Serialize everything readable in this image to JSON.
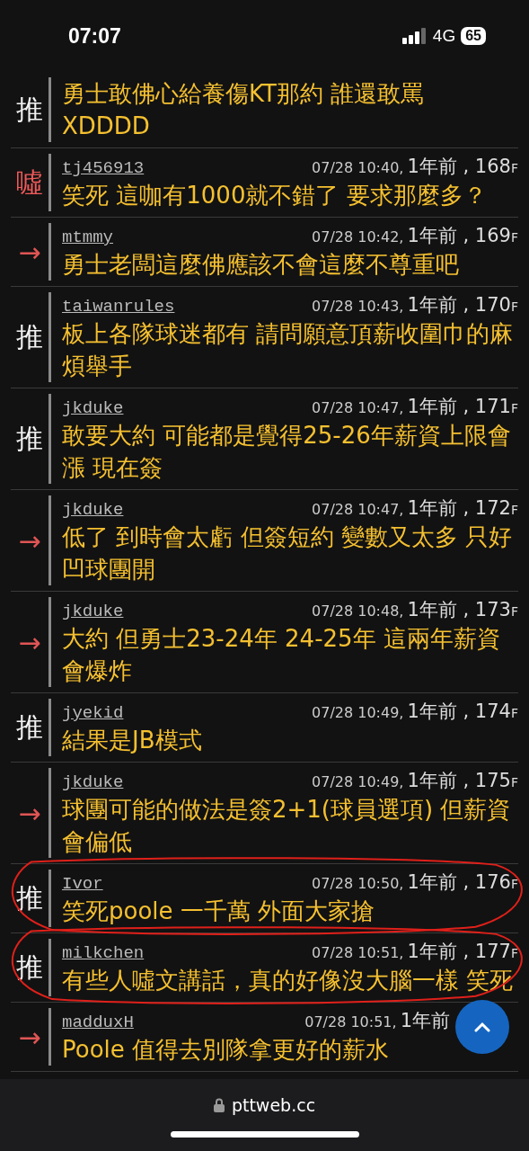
{
  "status_bar": {
    "time": "07:07",
    "network": "4G",
    "battery": "65"
  },
  "comments": [
    {
      "kind": "push",
      "tag": "推",
      "text": "勇士敢佛心給養傷KT那約 誰還敢罵 XDDDD",
      "circled": false
    },
    {
      "kind": "boo",
      "tag": "噓",
      "user": "tj456913",
      "time": "07/28 10:40,",
      "age": "1年前 , 168",
      "floor": "F",
      "text": "笑死 這咖有1000就不錯了 要求那麼多？",
      "circled": false
    },
    {
      "kind": "arrow",
      "tag": "→",
      "user": "mtmmy",
      "time": "07/28 10:42,",
      "age": "1年前 , 169",
      "floor": "F",
      "text": "勇士老闆這麼佛應該不會這麼不尊重吧",
      "circled": false
    },
    {
      "kind": "push",
      "tag": "推",
      "user": "taiwanrules",
      "time": "07/28 10:43,",
      "age": "1年前 , 170",
      "floor": "F",
      "text": "板上各隊球迷都有 請問願意頂薪收圍巾的麻煩舉手",
      "circled": false
    },
    {
      "kind": "push",
      "tag": "推",
      "user": "jkduke",
      "time": "07/28 10:47,",
      "age": "1年前 , 171",
      "floor": "F",
      "text": "敢要大約 可能都是覺得25-26年薪資上限會漲 現在簽",
      "circled": false
    },
    {
      "kind": "arrow",
      "tag": "→",
      "user": "jkduke",
      "time": "07/28 10:47,",
      "age": "1年前 , 172",
      "floor": "F",
      "text": "低了 到時會太虧 但簽短約 變數又太多 只好凹球團開",
      "circled": false
    },
    {
      "kind": "arrow",
      "tag": "→",
      "user": "jkduke",
      "time": "07/28 10:48,",
      "age": "1年前 , 173",
      "floor": "F",
      "text": "大約 但勇士23-24年 24-25年 這兩年薪資會爆炸",
      "circled": false
    },
    {
      "kind": "push",
      "tag": "推",
      "user": "jyekid",
      "time": "07/28 10:49,",
      "age": "1年前 , 174",
      "floor": "F",
      "text": "結果是JB模式",
      "circled": false
    },
    {
      "kind": "arrow",
      "tag": "→",
      "user": "jkduke",
      "time": "07/28 10:49,",
      "age": "1年前 , 175",
      "floor": "F",
      "text": "球團可能的做法是簽2+1(球員選項) 但薪資會偏低",
      "circled": false
    },
    {
      "kind": "push",
      "tag": "推",
      "user": "Ivor",
      "time": "07/28 10:50,",
      "age": "1年前 , 176",
      "floor": "F",
      "text": "笑死poole 一千萬 外面大家搶",
      "circled": true
    },
    {
      "kind": "push",
      "tag": "推",
      "user": "milkchen",
      "time": "07/28 10:51,",
      "age": "1年前 , 177",
      "floor": "F",
      "text": "有些人噓文講話，真的好像沒大腦一樣 笑死",
      "circled": true
    },
    {
      "kind": "arrow",
      "tag": "→",
      "user": "madduxH",
      "time": "07/28 10:51,",
      "age": "1年前",
      "text": "Poole 值得去別隊拿更好的薪水",
      "circled": false
    }
  ],
  "address_bar": {
    "url": "pttweb.cc"
  }
}
